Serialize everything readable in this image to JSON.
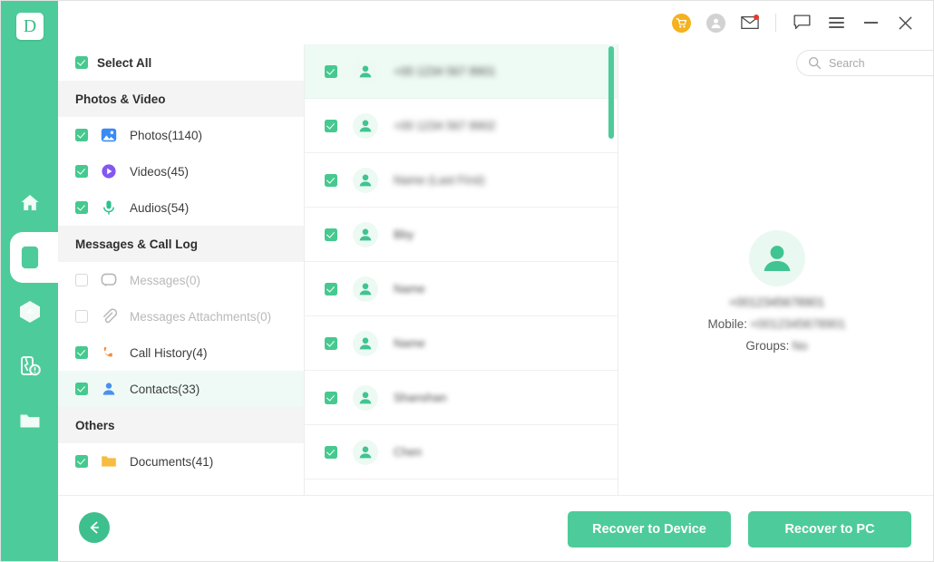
{
  "app": {
    "logo_letter": "D",
    "accent_green": "#4ecb9a",
    "accent_green_soft": "#effaf6",
    "cart_yellow": "#f5b21c",
    "badge_red": "#e8392e"
  },
  "titlebar": {
    "icons": [
      {
        "name": "cart-icon",
        "label": "Store"
      },
      {
        "name": "account-icon",
        "label": "Account"
      },
      {
        "name": "mail-icon",
        "label": "Messages",
        "badge": true
      },
      {
        "name": "feedback-icon",
        "label": "Feedback"
      },
      {
        "name": "menu-icon",
        "label": "Menu"
      },
      {
        "name": "minimize-icon",
        "label": "Minimize"
      },
      {
        "name": "close-icon",
        "label": "Close"
      }
    ]
  },
  "rail": {
    "items": [
      {
        "name": "home",
        "icon": "home-icon",
        "active": false
      },
      {
        "name": "device",
        "icon": "phone-icon",
        "active": true
      },
      {
        "name": "cloud",
        "icon": "cloud-icon",
        "active": false
      },
      {
        "name": "repair",
        "icon": "broken-phone-icon",
        "active": false
      },
      {
        "name": "files",
        "icon": "folder-icon",
        "active": false
      }
    ]
  },
  "sidebar": {
    "select_all": "Select All",
    "groups": [
      {
        "title": "Photos & Video",
        "items": [
          {
            "label": "Photos(1140)",
            "icon": "photo-icon",
            "checked": true,
            "enabled": true,
            "selected": false
          },
          {
            "label": "Videos(45)",
            "icon": "video-icon",
            "checked": true,
            "enabled": true,
            "selected": false
          },
          {
            "label": "Audios(54)",
            "icon": "audio-icon",
            "checked": true,
            "enabled": true,
            "selected": false
          }
        ]
      },
      {
        "title": "Messages & Call Log",
        "items": [
          {
            "label": "Messages(0)",
            "icon": "message-icon",
            "checked": false,
            "enabled": false,
            "selected": false
          },
          {
            "label": "Messages Attachments(0)",
            "icon": "attachment-icon",
            "checked": false,
            "enabled": false,
            "selected": false
          },
          {
            "label": "Call History(4)",
            "icon": "call-icon",
            "checked": true,
            "enabled": true,
            "selected": false
          },
          {
            "label": "Contacts(33)",
            "icon": "contact-icon",
            "checked": true,
            "enabled": true,
            "selected": true
          }
        ]
      },
      {
        "title": "Others",
        "items": [
          {
            "label": "Documents(41)",
            "icon": "document-icon",
            "checked": true,
            "enabled": true,
            "selected": false
          }
        ]
      }
    ]
  },
  "search": {
    "placeholder": "Search",
    "value": ""
  },
  "contact_list": {
    "rows": [
      {
        "name": "+00 1234 567 8901",
        "checked": true,
        "selected": true,
        "redacted": true
      },
      {
        "name": "+00 1234 567 8902",
        "checked": true,
        "selected": false,
        "redacted": true
      },
      {
        "name": "Name (Last First)",
        "checked": true,
        "selected": false,
        "redacted": true
      },
      {
        "name": "Bby",
        "checked": true,
        "selected": false,
        "redacted": true
      },
      {
        "name": "Name",
        "checked": true,
        "selected": false,
        "redacted": true
      },
      {
        "name": "Name",
        "checked": true,
        "selected": false,
        "redacted": true
      },
      {
        "name": "Shanshan",
        "checked": true,
        "selected": false,
        "redacted": true
      },
      {
        "name": "Chen",
        "checked": true,
        "selected": false,
        "redacted": true
      }
    ],
    "scrollbar_visible": true
  },
  "detail": {
    "name": "+0012345678901",
    "mobile_label": "Mobile:",
    "mobile_value": "+0012345678901",
    "groups_label": "Groups:",
    "groups_value": "No"
  },
  "footer": {
    "back_label": "Back",
    "recover_to_device": "Recover to Device",
    "recover_to_pc": "Recover to PC"
  }
}
